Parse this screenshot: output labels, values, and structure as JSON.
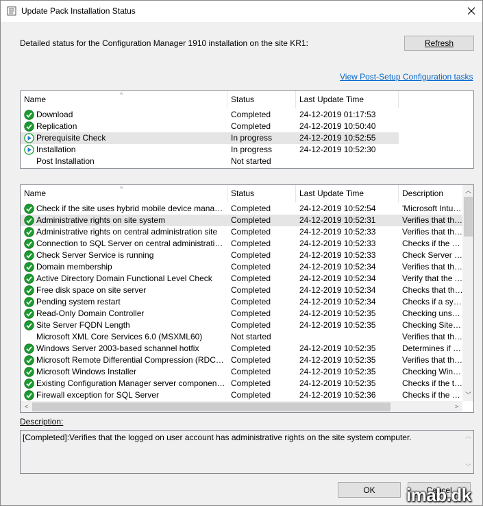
{
  "window": {
    "title": "Update Pack Installation Status",
    "close_glyph": "✕"
  },
  "detail_text": "Detailed status for the Configuration Manager 1910 installation on the site KR1:",
  "refresh_label": "Refresh",
  "post_setup_link": "View Post-Setup Configuration tasks",
  "steps": {
    "columns": [
      "Name",
      "Status",
      "Last Update Time"
    ],
    "rows": [
      {
        "name": "Download",
        "status": "Completed",
        "time": "24-12-2019 01:17:53",
        "icon": "completed-check-icon"
      },
      {
        "name": "Replication",
        "status": "Completed",
        "time": "24-12-2019 10:50:40",
        "icon": "completed-check-icon"
      },
      {
        "name": "Prerequisite Check",
        "status": "In progress",
        "time": "24-12-2019 10:52:55",
        "icon": "in-progress-play-icon"
      },
      {
        "name": "Installation",
        "status": "In progress",
        "time": "24-12-2019 10:52:30",
        "icon": "in-progress-play-icon"
      },
      {
        "name": "Post Installation",
        "status": "Not started",
        "time": "",
        "icon": "none"
      }
    ]
  },
  "checks": {
    "columns": [
      "Name",
      "Status",
      "Last Update Time",
      "Description"
    ],
    "rows": [
      {
        "name": "Check if the site uses hybrid mobile device management ...",
        "status": "Completed",
        "time": "24-12-2019 10:52:54",
        "desc": "'Microsoft Intune S",
        "icon": "completed-check-icon"
      },
      {
        "name": "Administrative rights on site system",
        "status": "Completed",
        "time": "24-12-2019 10:52:31",
        "desc": "Verifies that the log",
        "icon": "completed-check-icon"
      },
      {
        "name": "Administrative rights on central administration site",
        "status": "Completed",
        "time": "24-12-2019 10:52:33",
        "desc": "Verifies that the us",
        "icon": "completed-check-icon"
      },
      {
        "name": "Connection to SQL Server on central administration site",
        "status": "Completed",
        "time": "24-12-2019 10:52:33",
        "desc": "Checks if the user",
        "icon": "completed-check-icon"
      },
      {
        "name": "Check Server Service is running",
        "status": "Completed",
        "time": "24-12-2019 10:52:33",
        "desc": "Check Server Serv",
        "icon": "completed-check-icon"
      },
      {
        "name": "Domain membership",
        "status": "Completed",
        "time": "24-12-2019 10:52:34",
        "desc": "Verifies that the co",
        "icon": "completed-check-icon"
      },
      {
        "name": "Active Directory Domain Functional Level Check",
        "status": "Completed",
        "time": "24-12-2019 10:52:34",
        "desc": "Verify that the Activ",
        "icon": "completed-check-icon"
      },
      {
        "name": "Free disk space on site server",
        "status": "Completed",
        "time": "24-12-2019 10:52:34",
        "desc": "Checks that the sit",
        "icon": "completed-check-icon"
      },
      {
        "name": "Pending system restart",
        "status": "Completed",
        "time": "24-12-2019 10:52:34",
        "desc": "Checks if a system",
        "icon": "completed-check-icon"
      },
      {
        "name": "Read-Only Domain Controller",
        "status": "Completed",
        "time": "24-12-2019 10:52:35",
        "desc": "Checking unsuppo",
        "icon": "completed-check-icon"
      },
      {
        "name": "Site Server FQDN Length",
        "status": "Completed",
        "time": "24-12-2019 10:52:35",
        "desc": "Checking Site Serv",
        "icon": "completed-check-icon"
      },
      {
        "name": "Microsoft XML Core Services 6.0 (MSXML60)",
        "status": "Not started",
        "time": "",
        "desc": "Verifies that the Mi",
        "icon": "none"
      },
      {
        "name": "Windows Server 2003-based schannel hotfix",
        "status": "Completed",
        "time": "24-12-2019 10:52:35",
        "desc": "Determines if the W",
        "icon": "completed-check-icon"
      },
      {
        "name": "Microsoft Remote Differential Compression (RDC) library r...",
        "status": "Completed",
        "time": "24-12-2019 10:52:35",
        "desc": "Verifies that the Mi",
        "icon": "completed-check-icon"
      },
      {
        "name": "Microsoft Windows Installer",
        "status": "Completed",
        "time": "24-12-2019 10:52:35",
        "desc": "Checking Window",
        "icon": "completed-check-icon"
      },
      {
        "name": "Existing Configuration Manager server components on sit...",
        "status": "Completed",
        "time": "24-12-2019 10:52:35",
        "desc": "Checks if the targe",
        "icon": "completed-check-icon"
      },
      {
        "name": "Firewall exception for SQL Server",
        "status": "Completed",
        "time": "24-12-2019 10:52:36",
        "desc": "Checks if the Wind",
        "icon": "completed-check-icon"
      }
    ]
  },
  "description_label": "Description:",
  "description_text": "[Completed]:Verifies that the logged on user account has administrative rights on the site system computer.",
  "ok_label": "OK",
  "cancel_label": "Cancel",
  "watermark": "imab.dk",
  "colors": {
    "link": "#0066cc",
    "check_green": "#1a9c2e",
    "progress_blue": "#2b7fd4"
  }
}
